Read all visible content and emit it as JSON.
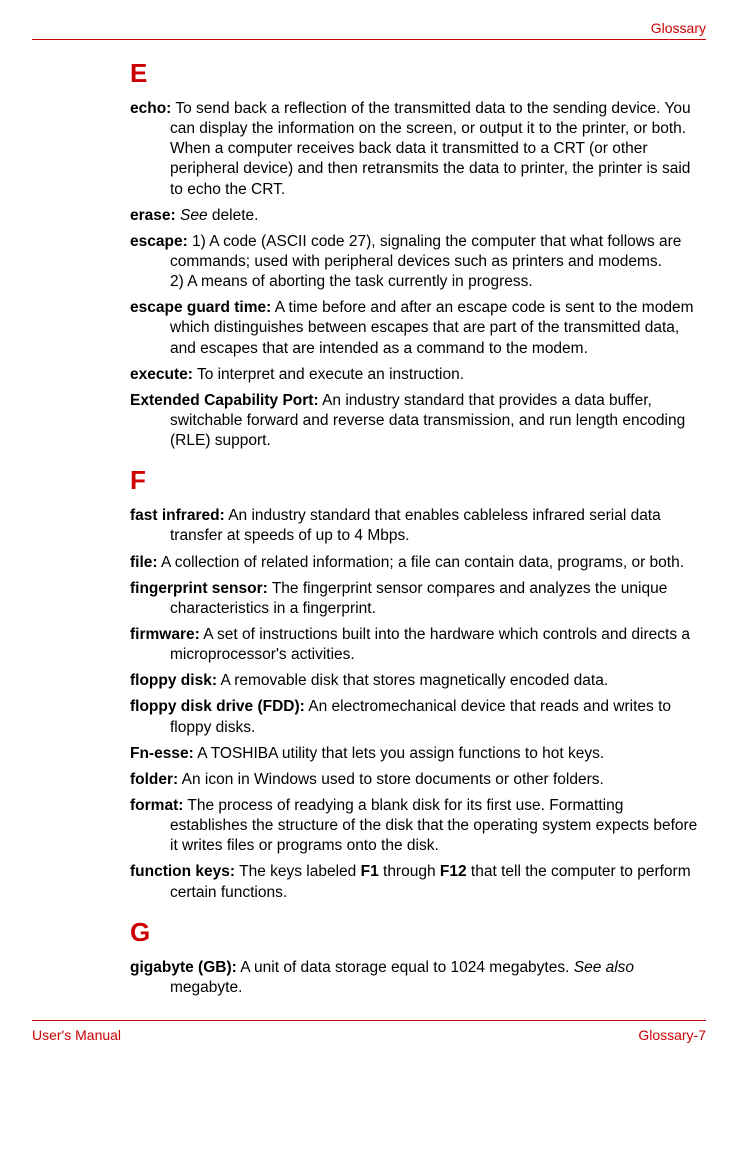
{
  "header": {
    "section_name": "Glossary"
  },
  "sections": {
    "E": {
      "letter": "E",
      "entries": {
        "echo": {
          "term": "echo:",
          "def": "To send back a reflection of the transmitted data to the sending device. You can display the information on the screen, or output it to the printer, or both. When a computer receives back data it transmitted to a CRT (or other peripheral device) and then retransmits the data to printer, the printer is said to echo the CRT."
        },
        "erase": {
          "term": "erase:",
          "see": "See",
          "ref": " delete."
        },
        "escape": {
          "term": "escape:",
          "def1": "1) A code (ASCII code 27), signaling the computer that what follows are commands; used with peripheral devices such as printers and modems.",
          "def2": "2) A means of aborting the task currently in progress."
        },
        "escape_guard": {
          "term": "escape guard time:",
          "def": "A time before and after an escape code is sent to the modem which distinguishes between escapes that are part of the transmitted data, and escapes that are intended as a command to the modem."
        },
        "execute": {
          "term": "execute:",
          "def": "To interpret and execute an instruction."
        },
        "ecp": {
          "term": "Extended Capability Port:",
          "def": "An industry standard that provides a data buffer, switchable forward and reverse data transmission, and run length encoding (RLE) support."
        }
      }
    },
    "F": {
      "letter": "F",
      "entries": {
        "fast_infrared": {
          "term": "fast infrared:",
          "def": "An industry standard that enables cableless infrared serial data transfer at speeds of up to 4 Mbps."
        },
        "file": {
          "term": "file:",
          "def": "A collection of related information; a file can contain data, programs, or both."
        },
        "fingerprint": {
          "term": "fingerprint sensor:",
          "def": " The fingerprint sensor compares and analyzes the unique characteristics in a fingerprint."
        },
        "firmware": {
          "term": "firmware:",
          "def": "A set of instructions built into the hardware which controls and directs a microprocessor's activities."
        },
        "floppy_disk": {
          "term": "floppy disk:",
          "def": "A removable disk that stores magnetically encoded data."
        },
        "fdd": {
          "term": "floppy disk drive (FDD):",
          "def": "An electromechanical device that reads and writes to floppy disks."
        },
        "fn_esse": {
          "term": "Fn-esse:",
          "def": "A TOSHIBA utility that lets you assign functions to hot keys."
        },
        "folder": {
          "term": "folder:",
          "def": "An icon in Windows used to store documents or other folders."
        },
        "format": {
          "term": "format:",
          "def": "The process of readying a blank disk for its first use. Formatting establishes the structure of the disk that the operating system expects before it writes files or programs onto the disk."
        },
        "function_keys": {
          "term": "function keys:",
          "def_pre": "The keys labeled ",
          "f1": "F1",
          "mid": " through ",
          "f12": "F12",
          "def_post": " that tell the computer to perform certain functions."
        }
      }
    },
    "G": {
      "letter": "G",
      "entries": {
        "gb": {
          "term": "gigabyte (GB):",
          "def_pre": "A unit of data storage equal to 1024 megabytes. ",
          "see": "See also",
          "ref": " megabyte."
        }
      }
    }
  },
  "footer": {
    "manual": "User's Manual",
    "page": "Glossary-7"
  }
}
